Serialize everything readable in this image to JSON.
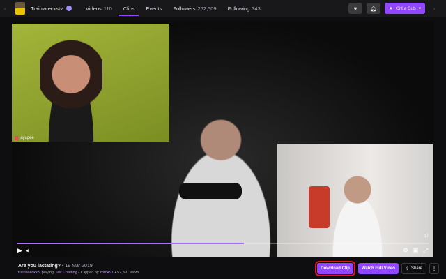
{
  "header": {
    "channel": "Trainwreckstv",
    "nav": [
      {
        "label": "Videos",
        "count": "110"
      },
      {
        "label": "Clips",
        "count": ""
      },
      {
        "label": "Events",
        "count": ""
      },
      {
        "label": "Followers",
        "count": "252,509"
      },
      {
        "label": "Following",
        "count": "343"
      }
    ],
    "gift_label": "Gift a Sub"
  },
  "video": {
    "cam_label": "jaycgee",
    "viewers": "17",
    "progress_percent": 55
  },
  "clip": {
    "title": "Are you lactating?",
    "date": "• 19 Mar 2019",
    "streamer": "trainwreckstv",
    "playing": "playing",
    "game": "Just Chatting",
    "clipped_by": "• Clipped by",
    "clipper": "zoro491",
    "views": "• 52,891 views"
  },
  "actions": {
    "download": "Download Clip",
    "watch": "Watch Full Video",
    "share": "Share"
  }
}
